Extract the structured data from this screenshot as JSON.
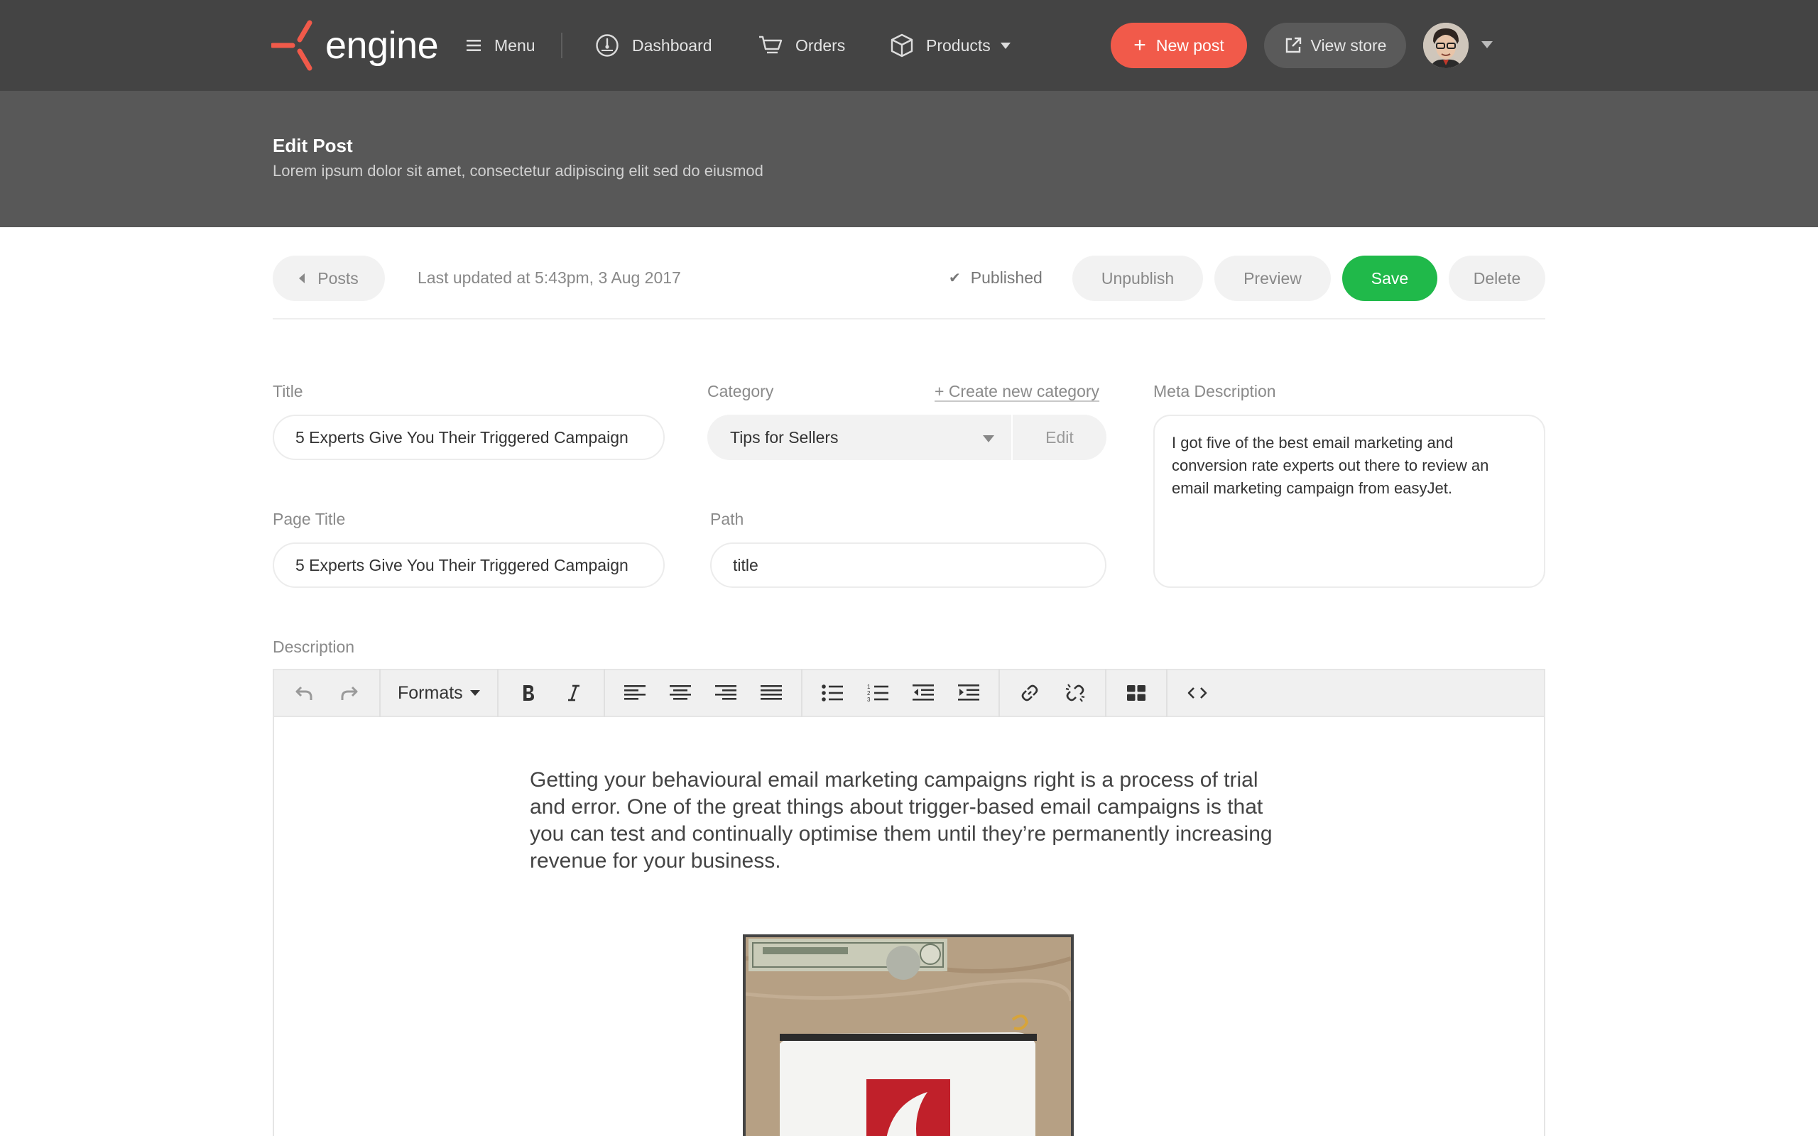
{
  "app": {
    "logo_text": "engine"
  },
  "nav": {
    "menu_label": "Menu",
    "dashboard_label": "Dashboard",
    "orders_label": "Orders",
    "products_label": "Products",
    "new_post_label": "New post",
    "view_store_label": "View store"
  },
  "header": {
    "title": "Edit Post",
    "subtitle": "Lorem ipsum dolor sit amet, consectetur adipiscing elit sed do eiusmod"
  },
  "actionbar": {
    "back_label": "Posts",
    "last_updated": "Last updated at 5:43pm, 3 Aug 2017",
    "status": "Published",
    "unpublish_label": "Unpublish",
    "preview_label": "Preview",
    "save_label": "Save",
    "delete_label": "Delete"
  },
  "form": {
    "title_label": "Title",
    "title_value": "5 Experts Give You Their Triggered Campaign",
    "category_label": "Category",
    "create_category_label": "+ Create new category",
    "category_value": "Tips for Sellers",
    "category_edit_label": "Edit",
    "meta_label": "Meta Description",
    "meta_value": "I got five of the best email marketing and conversion rate experts out there to review an email marketing campaign from easyJet.",
    "page_title_label": "Page Title",
    "page_title_value": "5 Experts Give You Their Triggered Campaign",
    "path_label": "Path",
    "path_value": "title",
    "description_label": "Description"
  },
  "editor": {
    "formats_label": "Formats",
    "body_text": "Getting your behavioural email marketing campaigns right is a process of trial and error. One of the great things about trigger-based email campaigns is that you can test and continually optimise them until they’re permanently increasing revenue for your business."
  },
  "colors": {
    "topbar": "#444444",
    "header_band": "#585858",
    "accent_red": "#f15a4a",
    "save_green": "#20b94a"
  }
}
